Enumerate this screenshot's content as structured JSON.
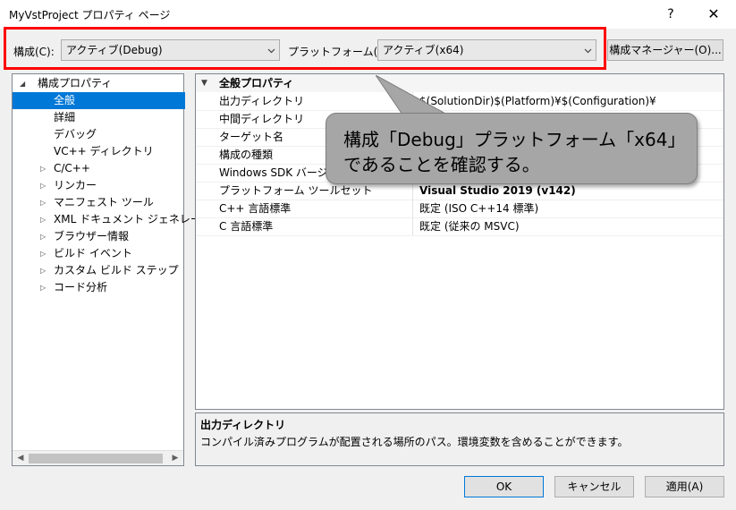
{
  "window": {
    "title": "MyVstProject プロパティ ページ",
    "help": "?",
    "close": "✕"
  },
  "toolbar": {
    "config_label": "構成(C):",
    "config_value": "アクティブ(Debug)",
    "platform_label": "プラットフォーム(P):",
    "platform_value": "アクティブ(x64)",
    "config_manager": "構成マネージャー(O)..."
  },
  "tree": {
    "root": "構成プロパティ",
    "items": [
      {
        "label": "全般",
        "selected": true,
        "expandable": false
      },
      {
        "label": "詳細",
        "selected": false,
        "expandable": false
      },
      {
        "label": "デバッグ",
        "selected": false,
        "expandable": false
      },
      {
        "label": "VC++ ディレクトリ",
        "selected": false,
        "expandable": false
      },
      {
        "label": "C/C++",
        "selected": false,
        "expandable": true
      },
      {
        "label": "リンカー",
        "selected": false,
        "expandable": true
      },
      {
        "label": "マニフェスト ツール",
        "selected": false,
        "expandable": true
      },
      {
        "label": "XML ドキュメント ジェネレーター",
        "selected": false,
        "expandable": true
      },
      {
        "label": "ブラウザー情報",
        "selected": false,
        "expandable": true
      },
      {
        "label": "ビルド イベント",
        "selected": false,
        "expandable": true
      },
      {
        "label": "カスタム ビルド ステップ",
        "selected": false,
        "expandable": true
      },
      {
        "label": "コード分析",
        "selected": false,
        "expandable": true
      }
    ]
  },
  "grid": {
    "section": "全般プロパティ",
    "rows": [
      {
        "name": "出力ディレクトリ",
        "value": "$(SolutionDir)$(Platform)¥$(Configuration)¥",
        "bold": false
      },
      {
        "name": "中間ディレクトリ",
        "value": "",
        "bold": false
      },
      {
        "name": "ターゲット名",
        "value": "",
        "bold": false
      },
      {
        "name": "構成の種類",
        "value": "",
        "bold": false
      },
      {
        "name": "Windows SDK バージョン",
        "value": "",
        "bold": false
      },
      {
        "name": "プラットフォーム ツールセット",
        "value": "Visual Studio 2019 (v142)",
        "bold": true
      },
      {
        "name": "C++ 言語標準",
        "value": "既定 (ISO C++14 標準)",
        "bold": false
      },
      {
        "name": "C 言語標準",
        "value": "既定 (従来の MSVC)",
        "bold": false
      }
    ]
  },
  "description": {
    "title": "出力ディレクトリ",
    "text": "コンパイル済みプログラムが配置される場所のパス。環境変数を含めることができます。"
  },
  "buttons": {
    "ok": "OK",
    "cancel": "キャンセル",
    "apply": "適用(A)"
  },
  "callout": {
    "line1": "構成「Debug」プラットフォーム「x64」",
    "line2": "であることを確認する。"
  },
  "colors": {
    "highlight_box": "#ff0000",
    "selection": "#0078d7",
    "callout_fill": "#a6a6a6"
  }
}
